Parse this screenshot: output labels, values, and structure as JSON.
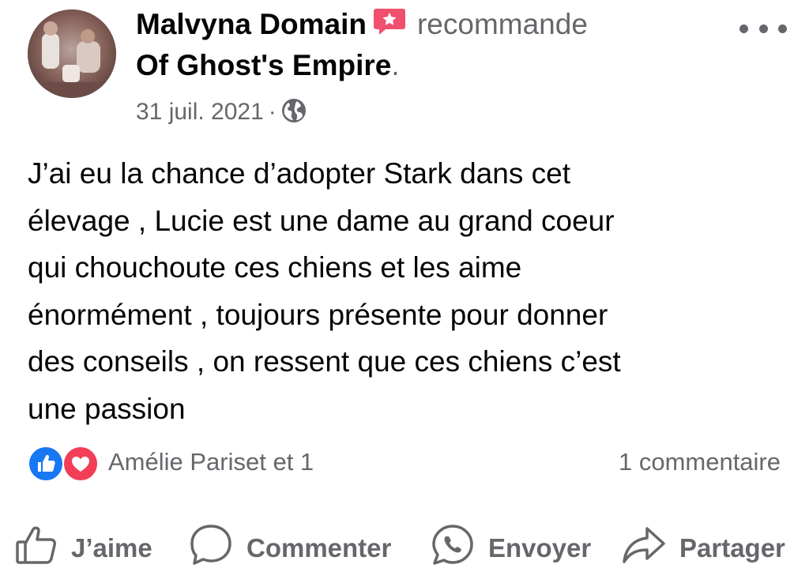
{
  "post": {
    "author": "Malvyna Domain",
    "verb": "recommande",
    "page_name": "Of Ghost's Empire",
    "page_suffix": ".",
    "date": "31 juil. 2021",
    "separator": "·",
    "privacy_icon": "globe-icon",
    "badge_icon": "recommendation-badge-icon",
    "more_icon": "more-options-icon",
    "body_lines": [
      "J’ai eu la chance d’adopter Stark dans cet",
      "élevage , Lucie est une dame au grand coeur",
      "qui chouchoute ces chiens et les aime",
      "énormément , toujours présente pour donner",
      "des conseils , on ressent que ces chiens c’est",
      "une passion"
    ]
  },
  "reactions": {
    "icons": [
      "like-reaction-icon",
      "love-reaction-icon"
    ],
    "summary": "Amélie Pariset et 1",
    "comments": "1 commentaire"
  },
  "actions": {
    "like": "J’aime",
    "comment": "Commenter",
    "send": "Envoyer",
    "share": "Partager"
  },
  "colors": {
    "primary_text": "#050505",
    "secondary_text": "#65676b",
    "like_blue": "#1877f2",
    "love_red": "#f33e58",
    "badge_red": "#f0506e"
  }
}
